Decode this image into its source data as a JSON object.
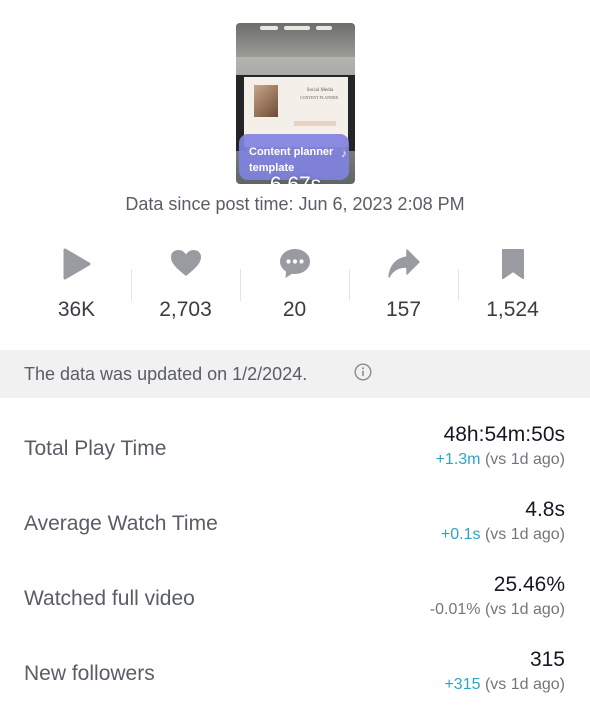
{
  "video": {
    "caption": "Content planner template",
    "duration": "6.67s",
    "doc_title": "Social Media",
    "doc_subtitle": "CONTENT PLANNER"
  },
  "since_text": "Data since post time: Jun 6, 2023 2:08 PM",
  "stats": [
    {
      "icon": "play-icon",
      "value": "36K"
    },
    {
      "icon": "heart-icon",
      "value": "2,703"
    },
    {
      "icon": "comment-icon",
      "value": "20"
    },
    {
      "icon": "share-icon",
      "value": "157"
    },
    {
      "icon": "bookmark-icon",
      "value": "1,524"
    }
  ],
  "updated_text": "The data was updated on 1/2/2024.",
  "metrics": [
    {
      "label": "Total Play Time",
      "value": "48h:54m:50s",
      "change": "+1.3m",
      "suffix": "(vs 1d ago)"
    },
    {
      "label": "Average Watch Time",
      "value": "4.8s",
      "change": "+0.1s",
      "suffix": "(vs 1d ago)"
    },
    {
      "label": "Watched full video",
      "value": "25.46%",
      "change": "-0.01%",
      "suffix": "(vs 1d ago)"
    },
    {
      "label": "New followers",
      "value": "315",
      "change": "+315",
      "suffix": "(vs 1d ago)"
    }
  ],
  "colors": {
    "icon_gray": "#9a9ba1",
    "positive_delta": "#2aa6c4",
    "banner_bg": "#f1f1f2",
    "caption_bg": "#8082de"
  }
}
